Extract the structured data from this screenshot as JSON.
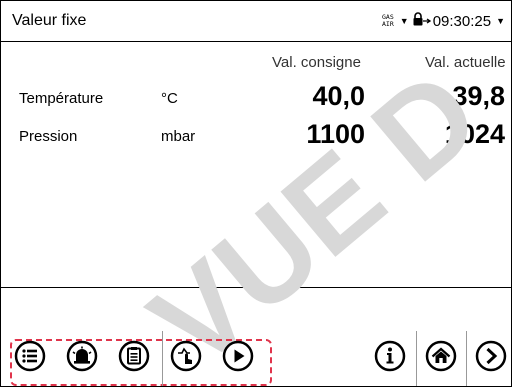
{
  "header": {
    "title": "Valeur fixe",
    "gas_line1": "GAS",
    "gas_line2": "AIR",
    "time": "09:30:25"
  },
  "table": {
    "col_setpoint": "Val. consigne",
    "col_actual": "Val. actuelle",
    "rows": [
      {
        "label": "Température",
        "unit": "°C",
        "setpoint": "40,0",
        "actual": "39,8"
      },
      {
        "label": "Pression",
        "unit": "mbar",
        "setpoint": "1100",
        "actual": "1024"
      }
    ]
  },
  "watermark": "VUE D",
  "colors": {
    "highlight": "#e0344b",
    "watermark": "#d8d8d8"
  },
  "icons": [
    "menu-icon",
    "alarm-icon",
    "clipboard-icon",
    "touch-icon",
    "play-icon",
    "info-icon",
    "home-icon",
    "next-icon"
  ]
}
